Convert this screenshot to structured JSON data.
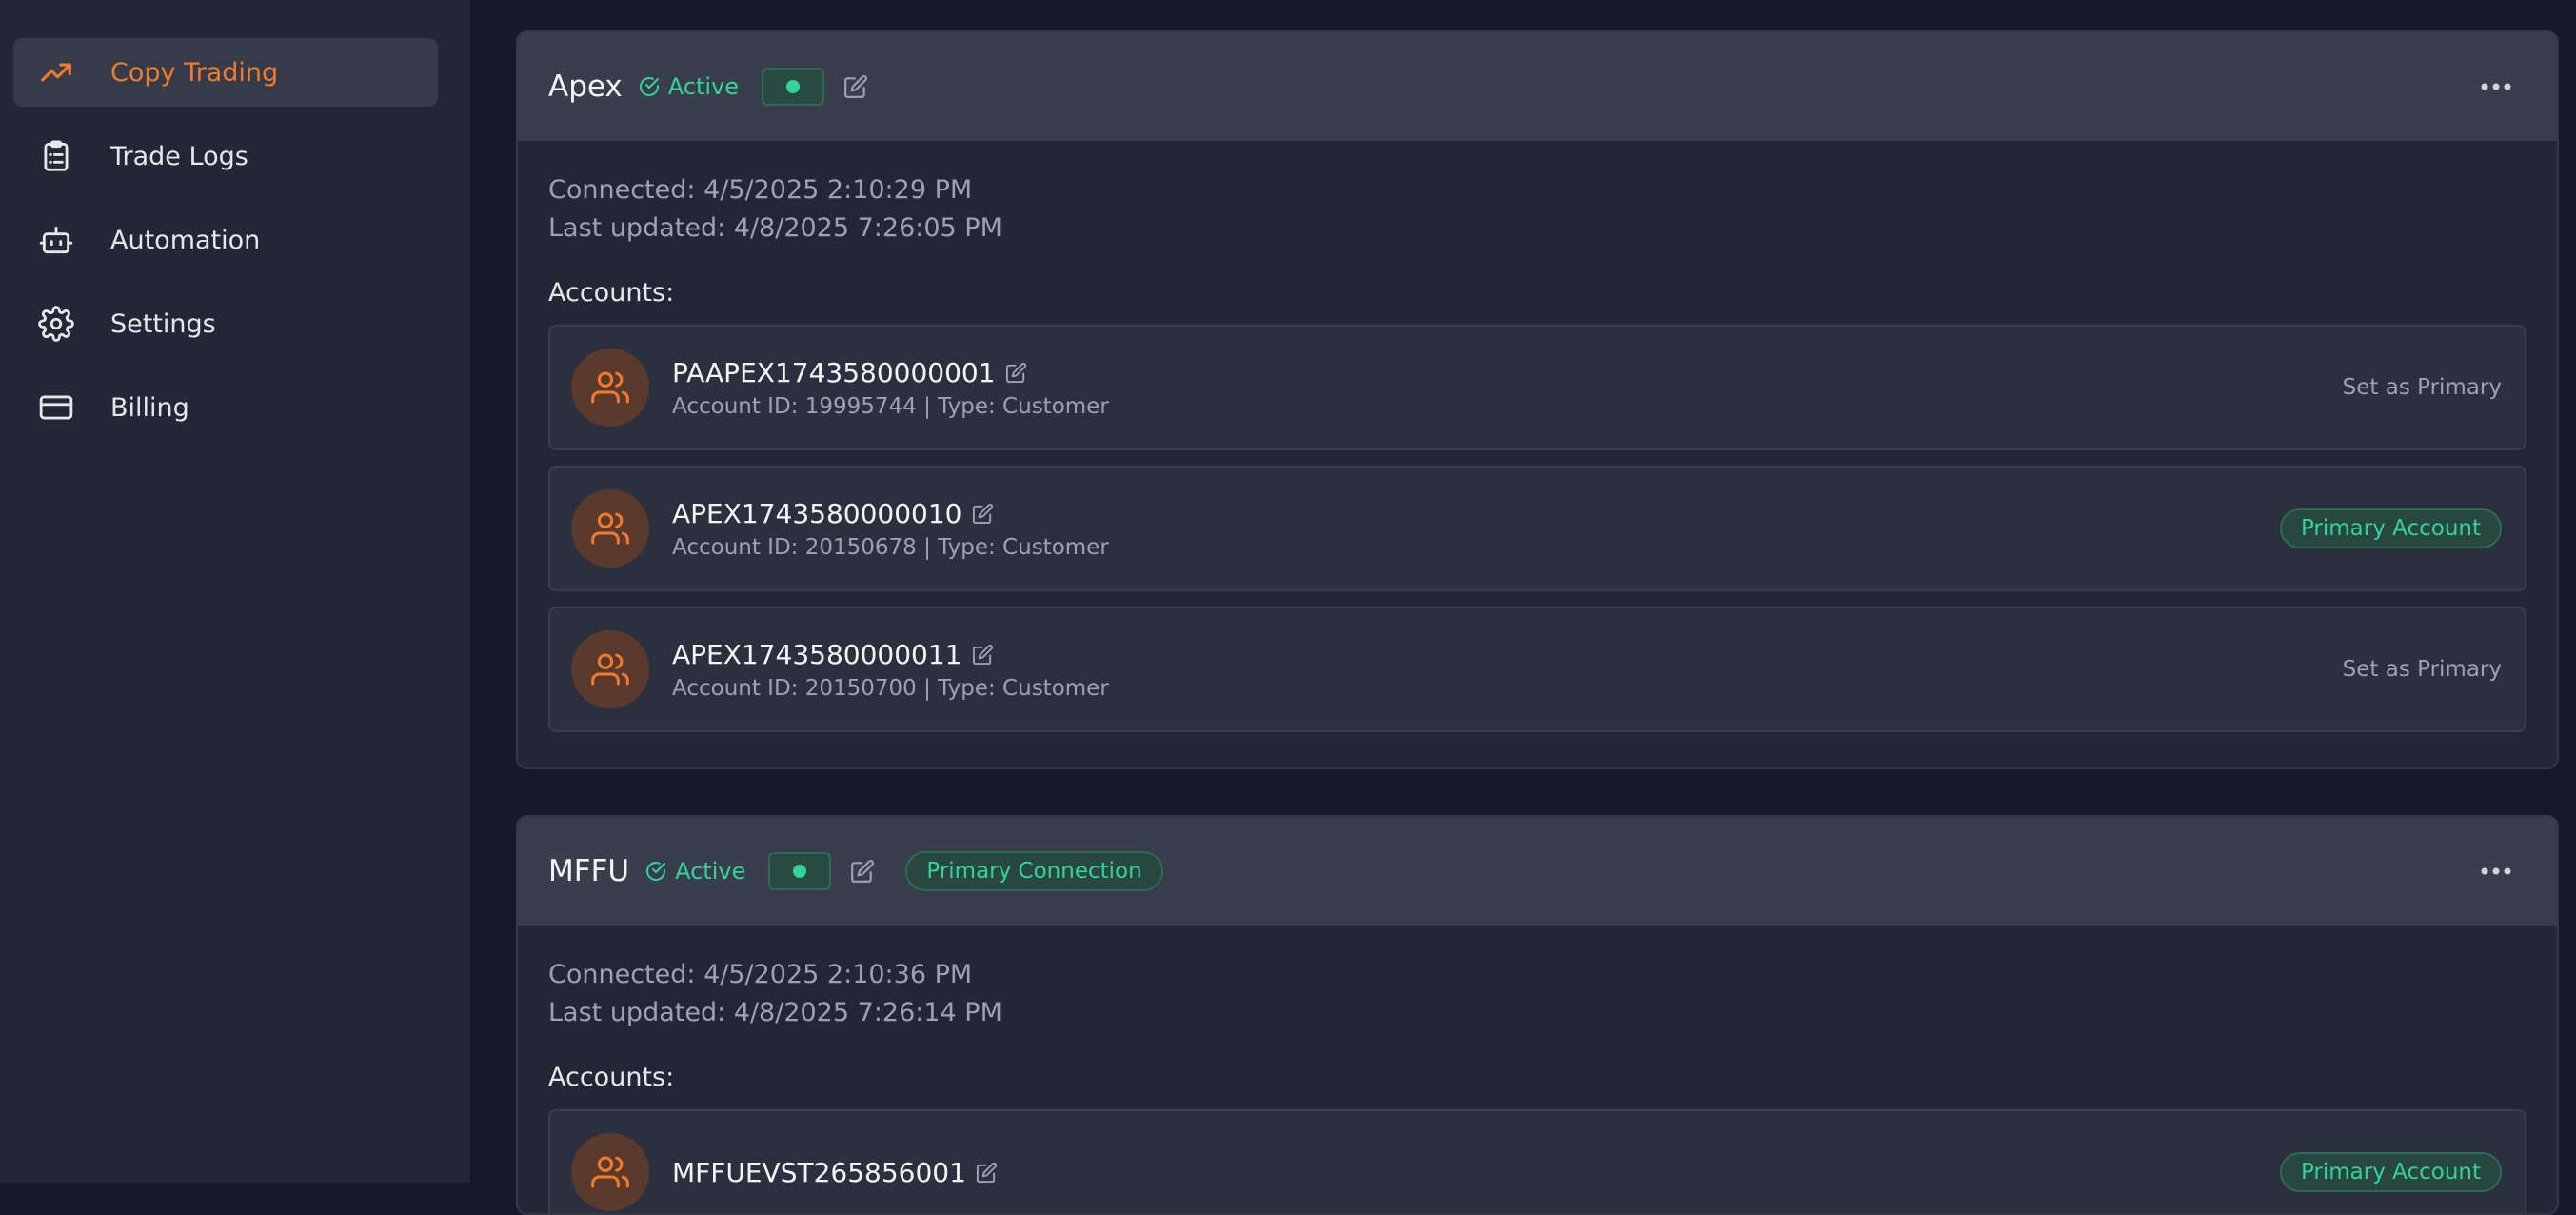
{
  "colors": {
    "accent": "#f37a2c",
    "success": "#34d399",
    "page_bg": "#141a27",
    "card_bg": "#212735",
    "header_bg": "#383e4c"
  },
  "sidebar": {
    "items": [
      {
        "label": "Copy Trading",
        "icon": "trending-up-icon",
        "active": true
      },
      {
        "label": "Trade Logs",
        "icon": "clipboard-list-icon"
      },
      {
        "label": "Automation",
        "icon": "robot-icon"
      },
      {
        "label": "Settings",
        "icon": "gear-icon"
      },
      {
        "label": "Billing",
        "icon": "credit-card-icon"
      }
    ]
  },
  "connections": [
    {
      "name": "Apex",
      "status": "Active",
      "connected": "Connected: 4/5/2025 2:10:29 PM",
      "last_updated": "Last updated: 4/8/2025 7:26:05 PM",
      "accounts_label": "Accounts:",
      "accounts": [
        {
          "name": "PAAPEX1743580000001",
          "details": "Account ID: 19995744 | Type: Customer",
          "action": "Set as Primary"
        },
        {
          "name": "APEX1743580000010",
          "details": "Account ID: 20150678 | Type: Customer",
          "badge": "Primary Account"
        },
        {
          "name": "APEX1743580000011",
          "details": "Account ID: 20150700 | Type: Customer",
          "action": "Set as Primary"
        }
      ]
    },
    {
      "name": "MFFU",
      "status": "Active",
      "primary_badge": "Primary Connection",
      "connected": "Connected: 4/5/2025 2:10:36 PM",
      "last_updated": "Last updated: 4/8/2025 7:26:14 PM",
      "accounts_label": "Accounts:",
      "accounts": [
        {
          "name": "MFFUEVST265856001",
          "badge": "Primary Account"
        }
      ]
    }
  ]
}
